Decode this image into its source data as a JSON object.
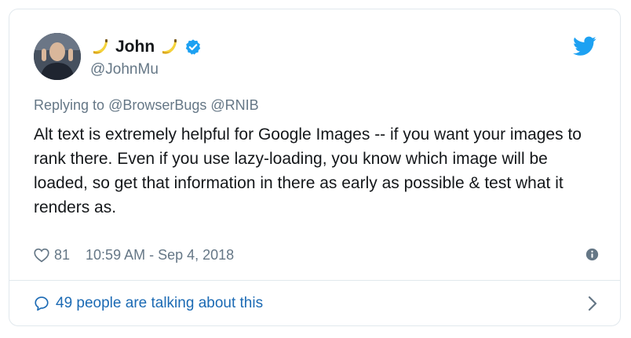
{
  "author": {
    "display_name": "John",
    "handle": "@JohnMu",
    "name_emoji": "banana-emoji",
    "verified": true
  },
  "platform_icon": "twitter-bird-icon",
  "reply": {
    "prefix": "Replying to ",
    "mentions": "@BrowserBugs @RNIB"
  },
  "tweet": {
    "text": "Alt text is extremely helpful for Google Images -- if you want your images to rank there. Even if you use lazy-loading, you know which image will be loaded, so get that information in there as early as possible & test what it renders as."
  },
  "meta": {
    "like_count": "81",
    "timestamp": "10:59 AM - Sep 4, 2018"
  },
  "discussion": {
    "label": "49 people are talking about this"
  },
  "colors": {
    "link": "#1b6ab4",
    "twitter_blue": "#1da1f2",
    "secondary_text": "#657786",
    "primary_text": "#14171a",
    "border": "#e1e8ed"
  }
}
